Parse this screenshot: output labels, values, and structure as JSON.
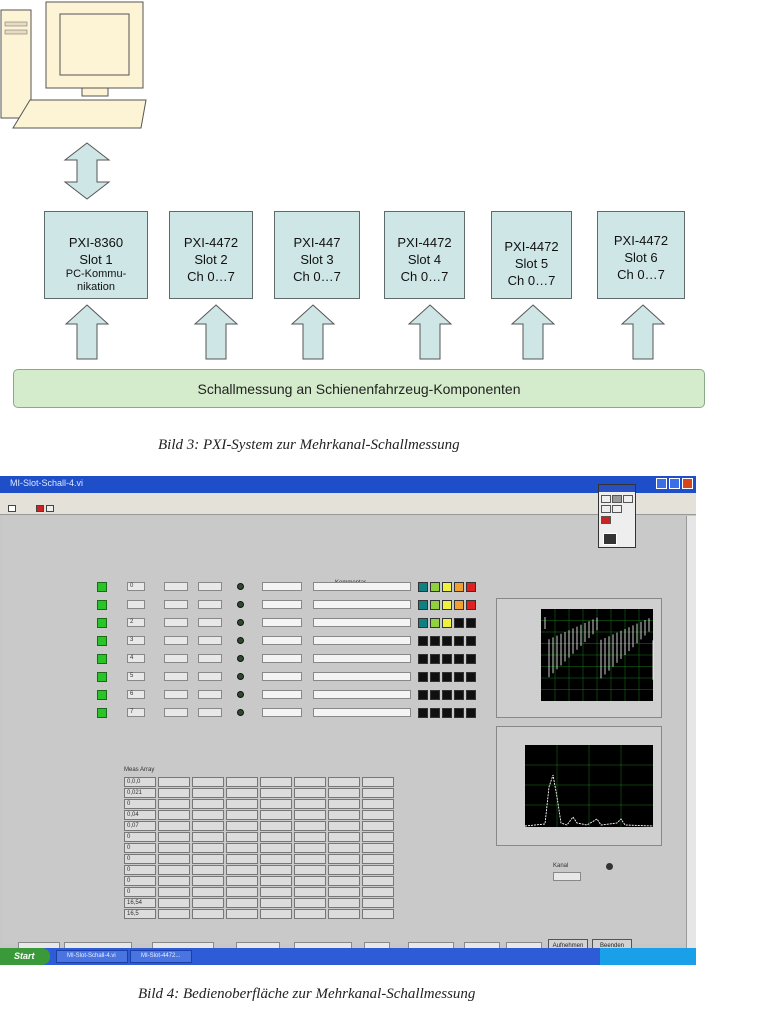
{
  "diagram": {
    "slots": [
      {
        "name": "PXI-8360",
        "slot": "Slot 1",
        "line3": "PC-Kommu-",
        "line4": "nikation"
      },
      {
        "name": "PXI-4472",
        "slot": "Slot 2",
        "line3": "Ch 0…7"
      },
      {
        "name": "PXI-447",
        "slot": "Slot 3",
        "line3": "Ch 0…7"
      },
      {
        "name": "PXI-4472",
        "slot": "Slot 4",
        "line3": "Ch 0…7"
      },
      {
        "name": "PXI-4472",
        "slot": "Slot 5",
        "line3": "Ch 0…7"
      },
      {
        "name": "PXI-4472",
        "slot": "Slot 6",
        "line3": "Ch 0…7"
      }
    ],
    "bus_label": "Schallmessung an Schienenfahrzeug-Komponenten",
    "caption": "Bild 3: PXI-System zur Mehrkanal-Schallmessung"
  },
  "screenshot": {
    "title": "MI-Slot-Schall-4.vi",
    "column_labels": [
      "Kommentar",
      "Meas Array"
    ],
    "channel_values": [
      "0",
      "",
      "2",
      "3",
      "4",
      "5",
      "6",
      "7"
    ],
    "array_col1": [
      "0,0,0",
      "0,021",
      "0",
      "0,04",
      "0,07",
      "0",
      "0",
      "0",
      "0",
      "0",
      "0",
      "16,54",
      "16,5"
    ],
    "kanal_label": "Kanal",
    "buttons": {
      "aufnehmen": "Aufnehmen",
      "beenden": "Beenden"
    },
    "start": "Start",
    "tasks": [
      "MI-Slot-Schall-4.vi",
      "MI-Slot-4472..."
    ],
    "led_colors_row1": [
      "#108080",
      "#90d040",
      "#f0f040",
      "#f0a030",
      "#e02020"
    ],
    "led_colors_row3": [
      "#108080",
      "#90d040",
      "#f0f040",
      "#101010",
      "#101010"
    ]
  },
  "caption2": "Bild 4: Bedienoberfläche zur Mehrkanal-Schallmessung"
}
